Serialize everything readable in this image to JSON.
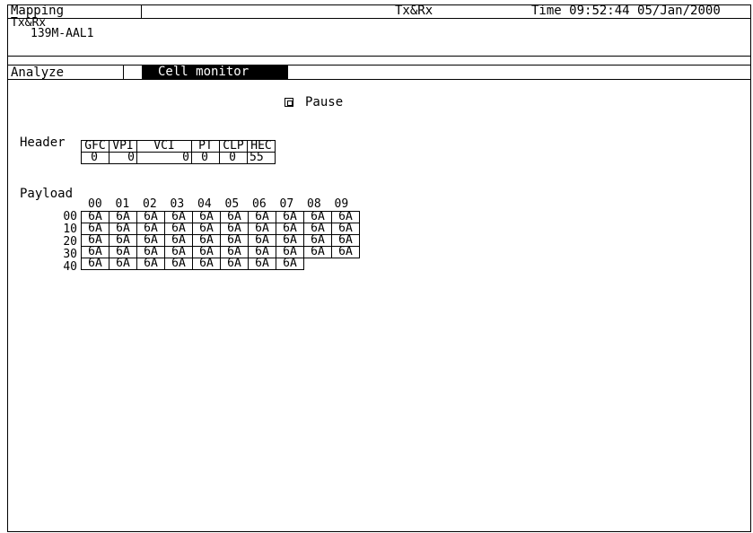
{
  "titlebar": {
    "mode": "Mapping",
    "center": "Tx&Rx",
    "time_label": "Time",
    "time": "09:52:44",
    "date": "05/Jan/2000"
  },
  "subtitle": {
    "line1": "Tx&Rx",
    "line2": "139M-AAL1"
  },
  "tabs": {
    "analyze": "Analyze",
    "cell_monitor": "Cell monitor"
  },
  "pause": {
    "label": "Pause",
    "checked": true
  },
  "header_section": {
    "label": "Header",
    "columns": [
      "GFC",
      "VPI",
      "VCI",
      "PT",
      "CLP",
      "HEC"
    ],
    "values": [
      "0",
      "0",
      "0",
      "0",
      "0",
      "55"
    ]
  },
  "payload_section": {
    "label": "Payload",
    "col_headers": [
      "00",
      "01",
      "02",
      "03",
      "04",
      "05",
      "06",
      "07",
      "08",
      "09"
    ],
    "rows": [
      {
        "label": "00",
        "cells": [
          "6A",
          "6A",
          "6A",
          "6A",
          "6A",
          "6A",
          "6A",
          "6A",
          "6A",
          "6A"
        ]
      },
      {
        "label": "10",
        "cells": [
          "6A",
          "6A",
          "6A",
          "6A",
          "6A",
          "6A",
          "6A",
          "6A",
          "6A",
          "6A"
        ]
      },
      {
        "label": "20",
        "cells": [
          "6A",
          "6A",
          "6A",
          "6A",
          "6A",
          "6A",
          "6A",
          "6A",
          "6A",
          "6A"
        ]
      },
      {
        "label": "30",
        "cells": [
          "6A",
          "6A",
          "6A",
          "6A",
          "6A",
          "6A",
          "6A",
          "6A",
          "6A",
          "6A"
        ]
      },
      {
        "label": "40",
        "cells": [
          "6A",
          "6A",
          "6A",
          "6A",
          "6A",
          "6A",
          "6A",
          "6A"
        ]
      }
    ]
  }
}
